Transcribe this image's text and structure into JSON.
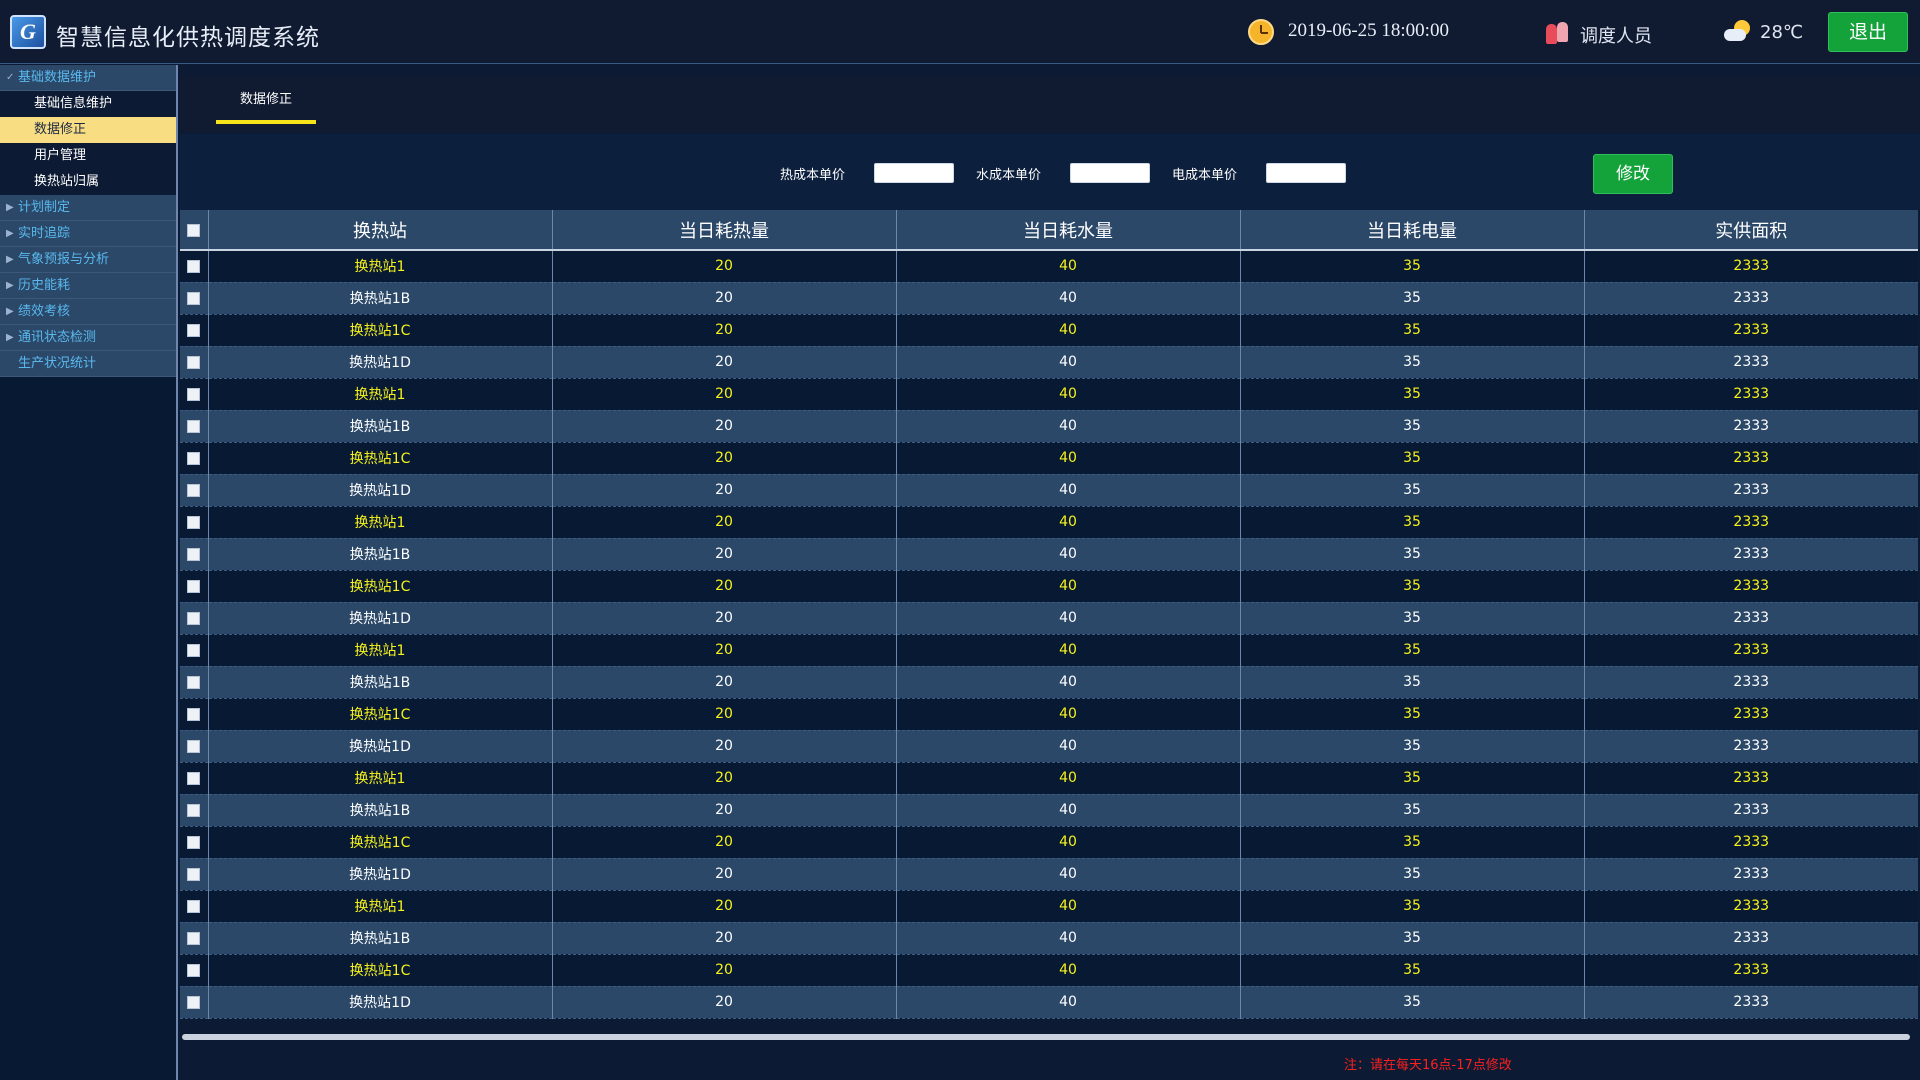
{
  "header": {
    "logo_text": "G",
    "app_title": "智慧信息化供热调度系统",
    "datetime": "2019-06-25 18:00:00",
    "user_role": "调度人员",
    "temperature": "28℃",
    "logout_label": "退出",
    "accent_color": "#14a33b"
  },
  "sidebar": {
    "groups": [
      {
        "label": "基础数据维护",
        "expanded": true,
        "children": [
          "基础信息维护",
          "数据修正",
          "用户管理",
          "换热站归属"
        ],
        "active_child": "数据修正"
      },
      {
        "label": "计划制定"
      },
      {
        "label": "实时追踪"
      },
      {
        "label": "气象预报与分析"
      },
      {
        "label": "历史能耗"
      },
      {
        "label": "绩效考核"
      },
      {
        "label": "通讯状态检测"
      },
      {
        "label": "生产状况统计"
      }
    ]
  },
  "tabs": [
    {
      "label": "数据修正",
      "active": true
    }
  ],
  "filters": {
    "heat_cost_label": "热成本单价",
    "water_cost_label": "水成本单价",
    "power_cost_label": "电成本单价",
    "heat_cost_value": "",
    "water_cost_value": "",
    "power_cost_value": "",
    "modify_label": "修改"
  },
  "table": {
    "headers": [
      "换热站",
      "当日耗热量",
      "当日耗水量",
      "当日耗电量",
      "实供面积"
    ],
    "rows": [
      [
        "换热站1",
        "20",
        "40",
        "35",
        "2333"
      ],
      [
        "换热站1B",
        "20",
        "40",
        "35",
        "2333"
      ],
      [
        "换热站1C",
        "20",
        "40",
        "35",
        "2333"
      ],
      [
        "换热站1D",
        "20",
        "40",
        "35",
        "2333"
      ],
      [
        "换热站1",
        "20",
        "40",
        "35",
        "2333"
      ],
      [
        "换热站1B",
        "20",
        "40",
        "35",
        "2333"
      ],
      [
        "换热站1C",
        "20",
        "40",
        "35",
        "2333"
      ],
      [
        "换热站1D",
        "20",
        "40",
        "35",
        "2333"
      ],
      [
        "换热站1",
        "20",
        "40",
        "35",
        "2333"
      ],
      [
        "换热站1B",
        "20",
        "40",
        "35",
        "2333"
      ],
      [
        "换热站1C",
        "20",
        "40",
        "35",
        "2333"
      ],
      [
        "换热站1D",
        "20",
        "40",
        "35",
        "2333"
      ],
      [
        "换热站1",
        "20",
        "40",
        "35",
        "2333"
      ],
      [
        "换热站1B",
        "20",
        "40",
        "35",
        "2333"
      ],
      [
        "换热站1C",
        "20",
        "40",
        "35",
        "2333"
      ],
      [
        "换热站1D",
        "20",
        "40",
        "35",
        "2333"
      ],
      [
        "换热站1",
        "20",
        "40",
        "35",
        "2333"
      ],
      [
        "换热站1B",
        "20",
        "40",
        "35",
        "2333"
      ],
      [
        "换热站1C",
        "20",
        "40",
        "35",
        "2333"
      ],
      [
        "换热站1D",
        "20",
        "40",
        "35",
        "2333"
      ],
      [
        "换热站1",
        "20",
        "40",
        "35",
        "2333"
      ],
      [
        "换热站1B",
        "20",
        "40",
        "35",
        "2333"
      ],
      [
        "换热站1C",
        "20",
        "40",
        "35",
        "2333"
      ],
      [
        "换热站1D",
        "20",
        "40",
        "35",
        "2333"
      ]
    ]
  },
  "note": "注：请在每天16点-17点修改",
  "colors": {
    "highlight_text": "#f7f21b",
    "note_red": "#ff1e1e",
    "row_dark": "#081a33",
    "row_light": "#2b4868"
  },
  "icons": {
    "clock": "clock-icon",
    "user": "user-icon",
    "weather": "sun-cloud-icon",
    "checkbox": "checkbox-icon"
  }
}
